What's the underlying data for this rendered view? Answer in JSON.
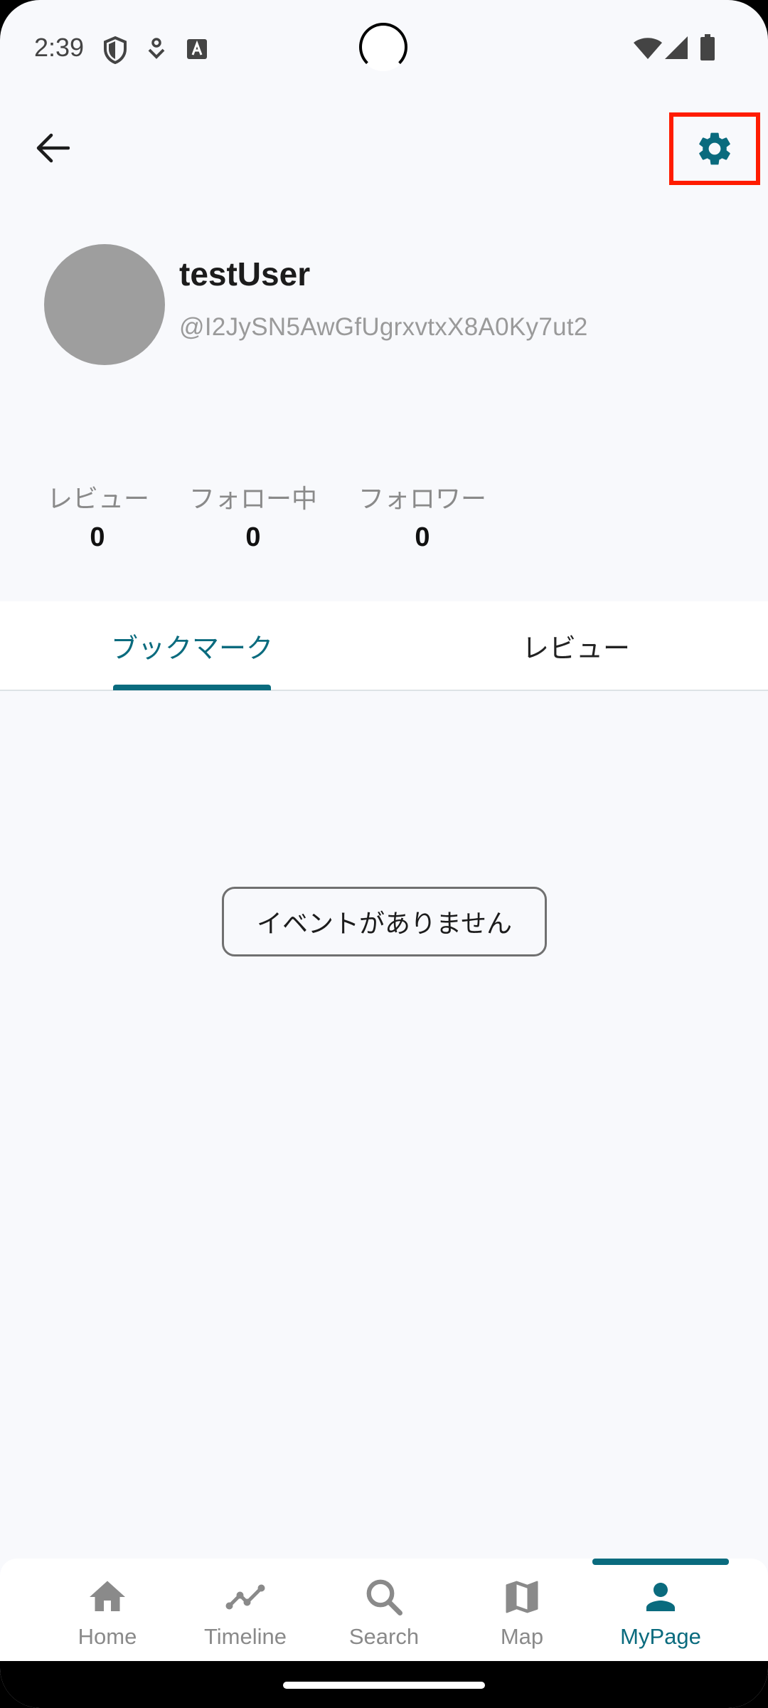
{
  "status_bar": {
    "time": "2:39",
    "icons": [
      "shield-icon",
      "download-badge-icon",
      "keyboard-a-icon",
      "wifi-icon",
      "signal-icon",
      "battery-icon"
    ]
  },
  "app_bar": {
    "back_icon": "arrow-left-icon",
    "settings_icon": "gear-icon",
    "highlight_color": "#ff1c00"
  },
  "profile": {
    "username": "testUser",
    "user_id": "@I2JySN5AwGfUgrxvtxX8A0Ky7ut2",
    "avatar_color": "#9e9e9e"
  },
  "stats": [
    {
      "label": "レビュー",
      "value": "0"
    },
    {
      "label": "フォロー中",
      "value": "0"
    },
    {
      "label": "フォロワー",
      "value": "0"
    }
  ],
  "tabs": [
    {
      "label": "ブックマーク",
      "selected": true
    },
    {
      "label": "レビュー",
      "selected": false
    }
  ],
  "empty_state": {
    "message": "イベントがありません"
  },
  "bottom_nav": {
    "accent_color": "#0a6b7e",
    "items": [
      {
        "label": "Home",
        "icon": "home-icon",
        "selected": false
      },
      {
        "label": "Timeline",
        "icon": "timeline-icon",
        "selected": false
      },
      {
        "label": "Search",
        "icon": "search-icon",
        "selected": false
      },
      {
        "label": "Map",
        "icon": "map-icon",
        "selected": false
      },
      {
        "label": "MyPage",
        "icon": "person-icon",
        "selected": true
      }
    ]
  }
}
